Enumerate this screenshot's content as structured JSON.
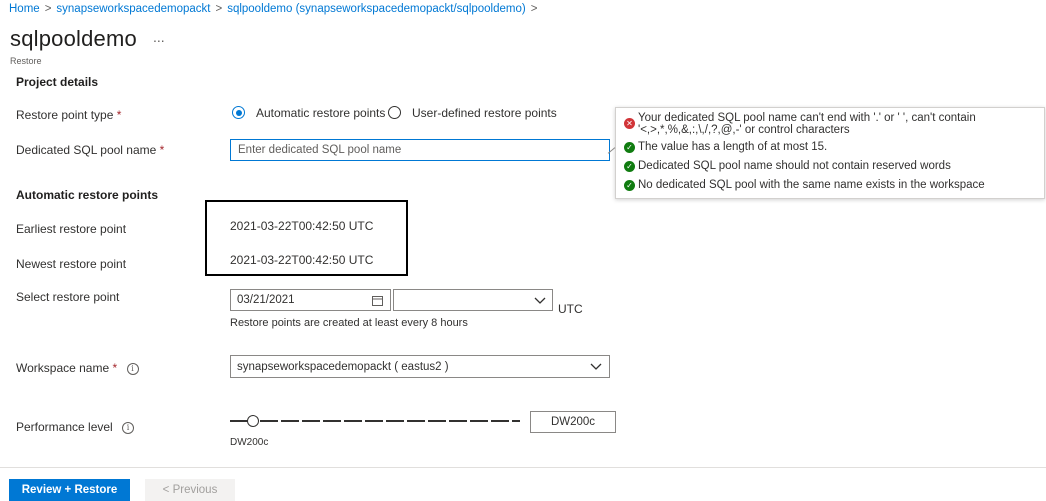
{
  "breadcrumb": {
    "items": [
      "Home",
      "synapseworkspacedemopackt",
      "sqlpooldemo (synapseworkspacedemopackt/sqlpooldemo)"
    ],
    "separator": ">"
  },
  "page": {
    "title": "sqlpooldemo",
    "more_label": "...",
    "subtitle": "Restore"
  },
  "project_details": {
    "heading": "Project details",
    "restore_point_type": {
      "label": "Restore point type",
      "required_mark": "*",
      "options": [
        {
          "label": "Automatic restore points",
          "selected": true
        },
        {
          "label": "User-defined restore points",
          "selected": false
        }
      ]
    },
    "pool_name": {
      "label": "Dedicated SQL pool name",
      "required_mark": "*",
      "value": "",
      "placeholder": "Enter dedicated SQL pool name"
    }
  },
  "validation": {
    "items": [
      {
        "status": "error",
        "icon": "error-circle-icon",
        "text": "Your dedicated SQL pool name can't end with '.' or ' ', can't contain '<,>,*,%,&,:,\\,/,?,@,-' or control characters"
      },
      {
        "status": "ok",
        "icon": "check-circle-icon",
        "text": "The value has a length of at most 15."
      },
      {
        "status": "ok",
        "icon": "check-circle-icon",
        "text": "Dedicated SQL pool name should not contain reserved words"
      },
      {
        "status": "ok",
        "icon": "check-circle-icon",
        "text": "No dedicated SQL pool with the same name exists in the workspace"
      }
    ]
  },
  "automatic_restore_points": {
    "heading": "Automatic restore points",
    "earliest": {
      "label": "Earliest restore point",
      "value": "2021-03-22T00:42:50 UTC"
    },
    "newest": {
      "label": "Newest restore point",
      "value": "2021-03-22T00:42:50 UTC"
    },
    "select": {
      "label": "Select restore point",
      "date": "03/21/2021",
      "time": "",
      "timezone": "UTC",
      "hint": "Restore points are created at least every 8 hours"
    }
  },
  "workspace": {
    "label": "Workspace name",
    "required_mark": "*",
    "value": "synapseworkspacedemopackt ( eastus2 )"
  },
  "performance": {
    "label": "Performance level",
    "value": "DW200c",
    "min_label": "DW200c",
    "slider_position": 0
  },
  "footer": {
    "primary_label": "Review + Restore",
    "previous_label": "< Previous"
  },
  "colors": {
    "accent": "#0078d4",
    "error": "#d13438",
    "success": "#107c10",
    "required": "#a4262c"
  }
}
